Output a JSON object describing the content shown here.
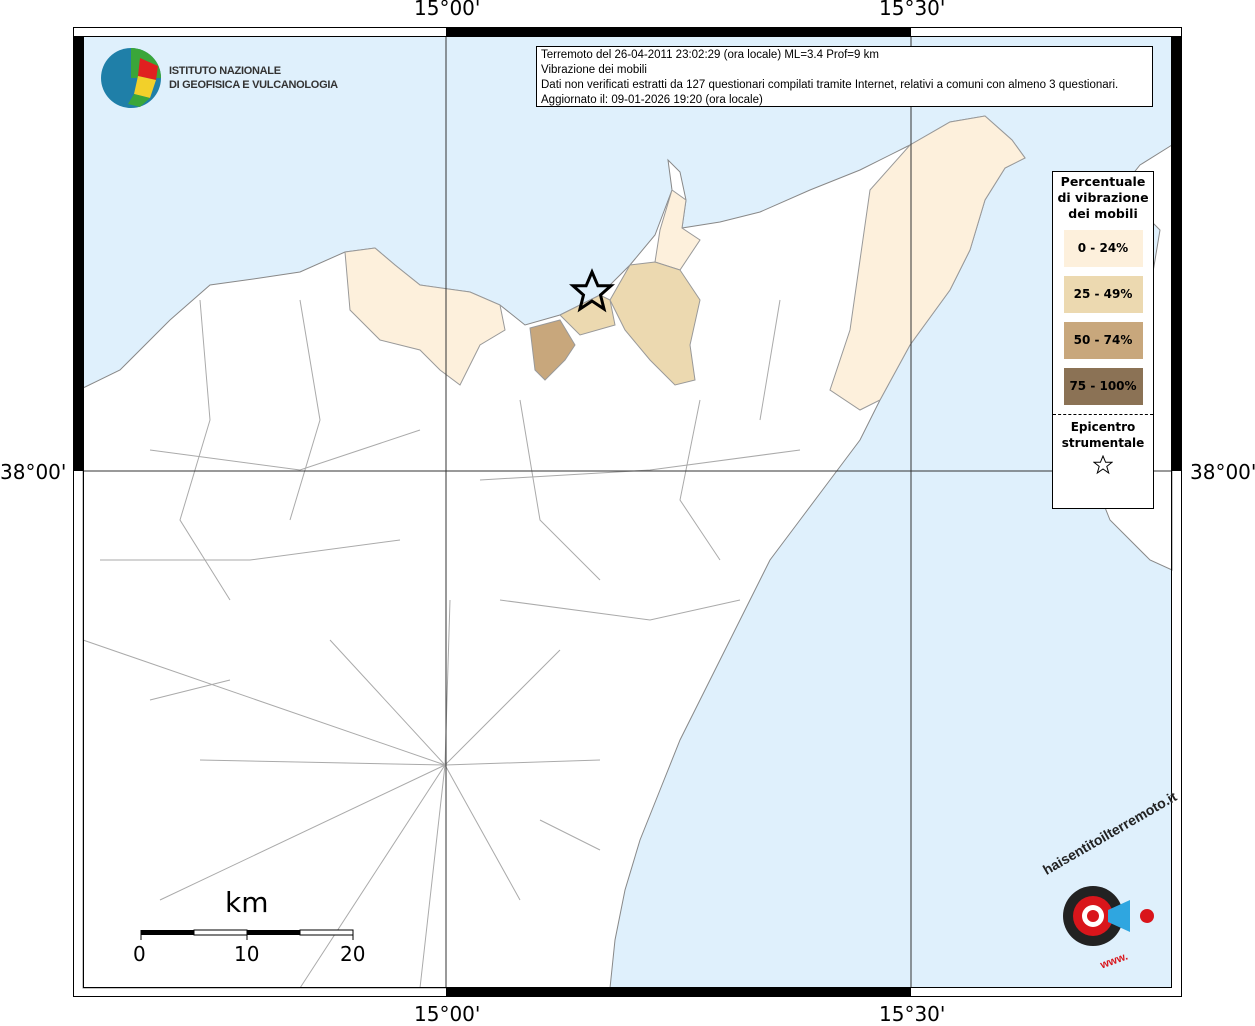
{
  "info": {
    "line1": "Terremoto del 26-04-2011 23:02:29 (ora locale) ML=3.4 Prof=9 km",
    "line2": "Vibrazione dei mobili",
    "line3": "Dati non verificati estratti da 127 questionari compilati tramite Internet, relativi a comuni con almeno 3 questionari.",
    "line4": "Aggiornato il: 09-01-2026 19:20 (ora locale)"
  },
  "logo": {
    "line1": "ISTITUTO NAZIONALE",
    "line2": "DI GEOFISICA E VULCANOLOGIA"
  },
  "axes": {
    "lon1": "15°00'",
    "lon2": "15°30'",
    "lat1": "38°00'"
  },
  "legend": {
    "title": "Percentuale di vibrazione dei mobili",
    "classes": [
      {
        "label": "0 - 24%",
        "color": "#fdf0dc"
      },
      {
        "label": "25 - 49%",
        "color": "#ecd9b0"
      },
      {
        "label": "50 - 74%",
        "color": "#c8a77c"
      },
      {
        "label": "75 - 100%",
        "color": "#8b7255"
      }
    ],
    "epicenter_label": "Epicentro strumentale"
  },
  "scale": {
    "unit": "km",
    "labels": [
      "0",
      "10",
      "20"
    ]
  },
  "brand": {
    "text": "haisentitoilterremoto.it",
    "prefix": "www."
  },
  "colors": {
    "sea": "#dff0fc",
    "land": "#ffffff",
    "boundary": "#aaaaaa"
  }
}
